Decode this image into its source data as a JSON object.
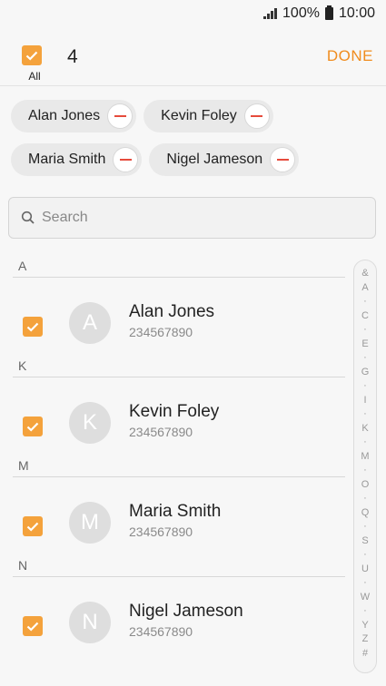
{
  "status": {
    "battery": "100%",
    "time": "10:00"
  },
  "header": {
    "all_label": "All",
    "selected_count": "4",
    "done_label": "DONE"
  },
  "chips": [
    {
      "label": "Alan Jones"
    },
    {
      "label": "Kevin Foley"
    },
    {
      "label": "Maria Smith"
    },
    {
      "label": "Nigel Jameson"
    }
  ],
  "search": {
    "placeholder": "Search"
  },
  "sections": [
    {
      "letter": "A",
      "name": "Alan Jones",
      "initial": "A",
      "phone": "234567890"
    },
    {
      "letter": "K",
      "name": "Kevin Foley",
      "initial": "K",
      "phone": "234567890"
    },
    {
      "letter": "M",
      "name": "Maria Smith",
      "initial": "M",
      "phone": "234567890"
    },
    {
      "letter": "N",
      "name": "Nigel Jameson",
      "initial": "N",
      "phone": "234567890"
    }
  ],
  "index_letters": [
    "&",
    "A",
    "·",
    "C",
    "·",
    "E",
    "·",
    "G",
    "·",
    "I",
    "·",
    "K",
    "·",
    "M",
    "·",
    "O",
    "·",
    "Q",
    "·",
    "S",
    "·",
    "U",
    "·",
    "W",
    "·",
    "Y",
    "Z",
    "#"
  ],
  "colors": {
    "accent": "#f4a23c",
    "done": "#f08c1e",
    "remove": "#e64b3c"
  }
}
